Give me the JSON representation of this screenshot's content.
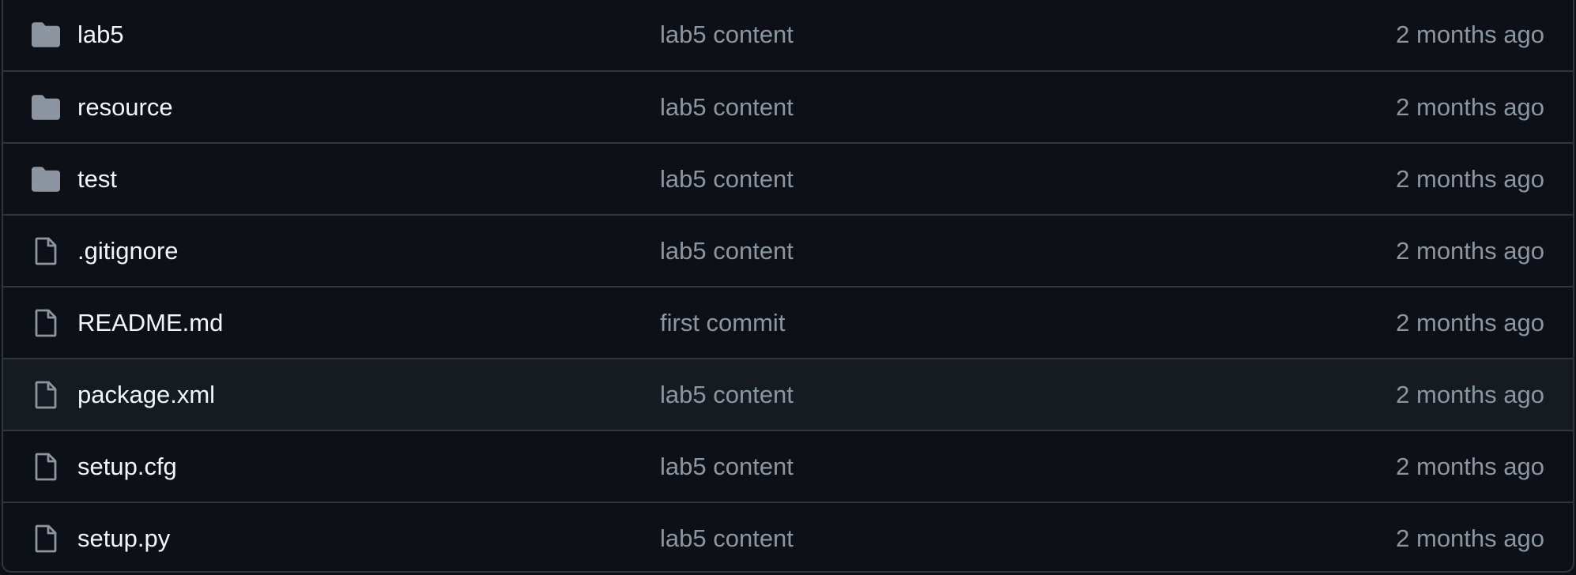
{
  "file_list": {
    "rows": [
      {
        "name": "lab5",
        "icon": "folder-icon",
        "commit": "lab5 content",
        "time": "2 months ago"
      },
      {
        "name": "resource",
        "icon": "folder-icon",
        "commit": "lab5 content",
        "time": "2 months ago"
      },
      {
        "name": "test",
        "icon": "folder-icon",
        "commit": "lab5 content",
        "time": "2 months ago"
      },
      {
        "name": ".gitignore",
        "icon": "file-icon",
        "commit": "lab5 content",
        "time": "2 months ago"
      },
      {
        "name": "README.md",
        "icon": "file-icon",
        "commit": "first commit",
        "time": "2 months ago"
      },
      {
        "name": "package.xml",
        "icon": "file-icon",
        "commit": "lab5 content",
        "time": "2 months ago"
      },
      {
        "name": "setup.cfg",
        "icon": "file-icon",
        "commit": "lab5 content",
        "time": "2 months ago"
      },
      {
        "name": "setup.py",
        "icon": "file-icon",
        "commit": "lab5 content",
        "time": "2 months ago"
      }
    ]
  },
  "colors": {
    "background": "#0d1117",
    "hover_row": "#161b22",
    "border": "#30363d",
    "name_text": "#f0f6fc",
    "muted_text": "#8d96a0",
    "folder_icon": "#8d96a0"
  }
}
